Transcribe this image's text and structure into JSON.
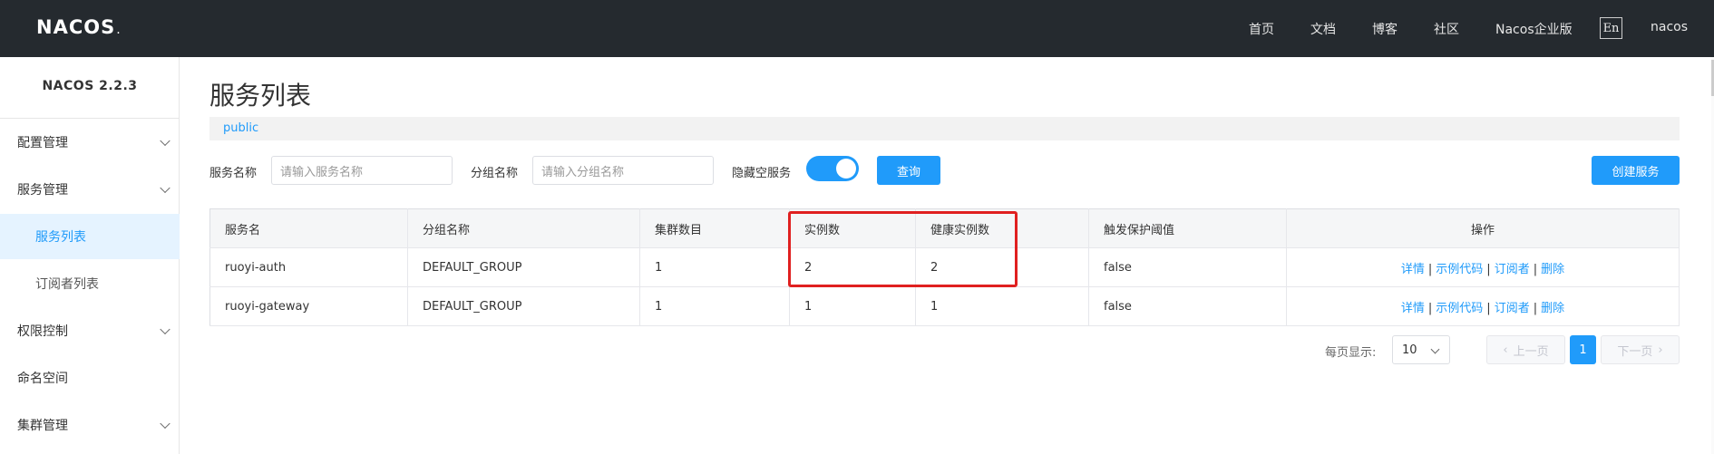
{
  "header": {
    "logo": "NACOS",
    "nav": [
      "首页",
      "文档",
      "博客",
      "社区",
      "Nacos企业版"
    ],
    "lang": "En",
    "user": "nacos"
  },
  "sidebar": {
    "title": "NACOS 2.2.3",
    "items": [
      {
        "label": "配置管理"
      },
      {
        "label": "服务管理"
      },
      {
        "label": "服务列表"
      },
      {
        "label": "订阅者列表"
      },
      {
        "label": "权限控制"
      },
      {
        "label": "命名空间"
      },
      {
        "label": "集群管理"
      }
    ]
  },
  "main": {
    "title": "服务列表",
    "namespace": "public",
    "filters": {
      "service_label": "服务名称",
      "service_placeholder": "请输入服务名称",
      "group_label": "分组名称",
      "group_placeholder": "请输入分组名称",
      "hide_empty_label": "隐藏空服务",
      "hide_empty_on": true,
      "query_button": "查询",
      "create_button": "创建服务"
    },
    "table": {
      "columns": [
        "服务名",
        "分组名称",
        "集群数目",
        "实例数",
        "健康实例数",
        "触发保护阈值",
        "操作"
      ],
      "rows": [
        [
          "ruoyi-auth",
          "DEFAULT_GROUP",
          "1",
          "2",
          "2",
          "false"
        ],
        [
          "ruoyi-gateway",
          "DEFAULT_GROUP",
          "1",
          "1",
          "1",
          "false"
        ]
      ],
      "ops": {
        "detail": "详情",
        "sample": "示例代码",
        "subscriber": "订阅者",
        "delete": "删除",
        "sep": "|"
      }
    },
    "pagination": {
      "per_page_label": "每页显示:",
      "per_page": "10",
      "prev": "上一页",
      "current": "1",
      "next": "下一页"
    }
  },
  "colors": {
    "accent": "#209bfa",
    "topbar": "#252a2f",
    "highlight": "#e02020"
  }
}
